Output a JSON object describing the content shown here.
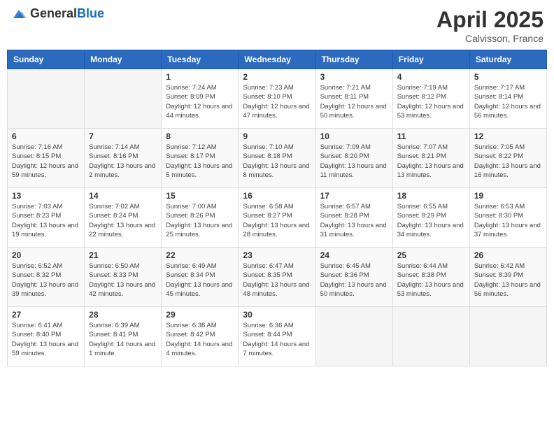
{
  "header": {
    "logo_general": "General",
    "logo_blue": "Blue",
    "month_title": "April 2025",
    "location": "Calvisson, France"
  },
  "days_of_week": [
    "Sunday",
    "Monday",
    "Tuesday",
    "Wednesday",
    "Thursday",
    "Friday",
    "Saturday"
  ],
  "weeks": [
    [
      {
        "day": "",
        "sunrise": "",
        "sunset": "",
        "daylight": ""
      },
      {
        "day": "",
        "sunrise": "",
        "sunset": "",
        "daylight": ""
      },
      {
        "day": "1",
        "sunrise": "Sunrise: 7:24 AM",
        "sunset": "Sunset: 8:09 PM",
        "daylight": "Daylight: 12 hours and 44 minutes."
      },
      {
        "day": "2",
        "sunrise": "Sunrise: 7:23 AM",
        "sunset": "Sunset: 8:10 PM",
        "daylight": "Daylight: 12 hours and 47 minutes."
      },
      {
        "day": "3",
        "sunrise": "Sunrise: 7:21 AM",
        "sunset": "Sunset: 8:11 PM",
        "daylight": "Daylight: 12 hours and 50 minutes."
      },
      {
        "day": "4",
        "sunrise": "Sunrise: 7:19 AM",
        "sunset": "Sunset: 8:12 PM",
        "daylight": "Daylight: 12 hours and 53 minutes."
      },
      {
        "day": "5",
        "sunrise": "Sunrise: 7:17 AM",
        "sunset": "Sunset: 8:14 PM",
        "daylight": "Daylight: 12 hours and 56 minutes."
      }
    ],
    [
      {
        "day": "6",
        "sunrise": "Sunrise: 7:16 AM",
        "sunset": "Sunset: 8:15 PM",
        "daylight": "Daylight: 12 hours and 59 minutes."
      },
      {
        "day": "7",
        "sunrise": "Sunrise: 7:14 AM",
        "sunset": "Sunset: 8:16 PM",
        "daylight": "Daylight: 13 hours and 2 minutes."
      },
      {
        "day": "8",
        "sunrise": "Sunrise: 7:12 AM",
        "sunset": "Sunset: 8:17 PM",
        "daylight": "Daylight: 13 hours and 5 minutes."
      },
      {
        "day": "9",
        "sunrise": "Sunrise: 7:10 AM",
        "sunset": "Sunset: 8:18 PM",
        "daylight": "Daylight: 13 hours and 8 minutes."
      },
      {
        "day": "10",
        "sunrise": "Sunrise: 7:09 AM",
        "sunset": "Sunset: 8:20 PM",
        "daylight": "Daylight: 13 hours and 11 minutes."
      },
      {
        "day": "11",
        "sunrise": "Sunrise: 7:07 AM",
        "sunset": "Sunset: 8:21 PM",
        "daylight": "Daylight: 13 hours and 13 minutes."
      },
      {
        "day": "12",
        "sunrise": "Sunrise: 7:05 AM",
        "sunset": "Sunset: 8:22 PM",
        "daylight": "Daylight: 13 hours and 16 minutes."
      }
    ],
    [
      {
        "day": "13",
        "sunrise": "Sunrise: 7:03 AM",
        "sunset": "Sunset: 8:23 PM",
        "daylight": "Daylight: 13 hours and 19 minutes."
      },
      {
        "day": "14",
        "sunrise": "Sunrise: 7:02 AM",
        "sunset": "Sunset: 8:24 PM",
        "daylight": "Daylight: 13 hours and 22 minutes."
      },
      {
        "day": "15",
        "sunrise": "Sunrise: 7:00 AM",
        "sunset": "Sunset: 8:26 PM",
        "daylight": "Daylight: 13 hours and 25 minutes."
      },
      {
        "day": "16",
        "sunrise": "Sunrise: 6:58 AM",
        "sunset": "Sunset: 8:27 PM",
        "daylight": "Daylight: 13 hours and 28 minutes."
      },
      {
        "day": "17",
        "sunrise": "Sunrise: 6:57 AM",
        "sunset": "Sunset: 8:28 PM",
        "daylight": "Daylight: 13 hours and 31 minutes."
      },
      {
        "day": "18",
        "sunrise": "Sunrise: 6:55 AM",
        "sunset": "Sunset: 8:29 PM",
        "daylight": "Daylight: 13 hours and 34 minutes."
      },
      {
        "day": "19",
        "sunrise": "Sunrise: 6:53 AM",
        "sunset": "Sunset: 8:30 PM",
        "daylight": "Daylight: 13 hours and 37 minutes."
      }
    ],
    [
      {
        "day": "20",
        "sunrise": "Sunrise: 6:52 AM",
        "sunset": "Sunset: 8:32 PM",
        "daylight": "Daylight: 13 hours and 39 minutes."
      },
      {
        "day": "21",
        "sunrise": "Sunrise: 6:50 AM",
        "sunset": "Sunset: 8:33 PM",
        "daylight": "Daylight: 13 hours and 42 minutes."
      },
      {
        "day": "22",
        "sunrise": "Sunrise: 6:49 AM",
        "sunset": "Sunset: 8:34 PM",
        "daylight": "Daylight: 13 hours and 45 minutes."
      },
      {
        "day": "23",
        "sunrise": "Sunrise: 6:47 AM",
        "sunset": "Sunset: 8:35 PM",
        "daylight": "Daylight: 13 hours and 48 minutes."
      },
      {
        "day": "24",
        "sunrise": "Sunrise: 6:45 AM",
        "sunset": "Sunset: 8:36 PM",
        "daylight": "Daylight: 13 hours and 50 minutes."
      },
      {
        "day": "25",
        "sunrise": "Sunrise: 6:44 AM",
        "sunset": "Sunset: 8:38 PM",
        "daylight": "Daylight: 13 hours and 53 minutes."
      },
      {
        "day": "26",
        "sunrise": "Sunrise: 6:42 AM",
        "sunset": "Sunset: 8:39 PM",
        "daylight": "Daylight: 13 hours and 56 minutes."
      }
    ],
    [
      {
        "day": "27",
        "sunrise": "Sunrise: 6:41 AM",
        "sunset": "Sunset: 8:40 PM",
        "daylight": "Daylight: 13 hours and 59 minutes."
      },
      {
        "day": "28",
        "sunrise": "Sunrise: 6:39 AM",
        "sunset": "Sunset: 8:41 PM",
        "daylight": "Daylight: 14 hours and 1 minute."
      },
      {
        "day": "29",
        "sunrise": "Sunrise: 6:38 AM",
        "sunset": "Sunset: 8:42 PM",
        "daylight": "Daylight: 14 hours and 4 minutes."
      },
      {
        "day": "30",
        "sunrise": "Sunrise: 6:36 AM",
        "sunset": "Sunset: 8:44 PM",
        "daylight": "Daylight: 14 hours and 7 minutes."
      },
      {
        "day": "",
        "sunrise": "",
        "sunset": "",
        "daylight": ""
      },
      {
        "day": "",
        "sunrise": "",
        "sunset": "",
        "daylight": ""
      },
      {
        "day": "",
        "sunrise": "",
        "sunset": "",
        "daylight": ""
      }
    ]
  ]
}
